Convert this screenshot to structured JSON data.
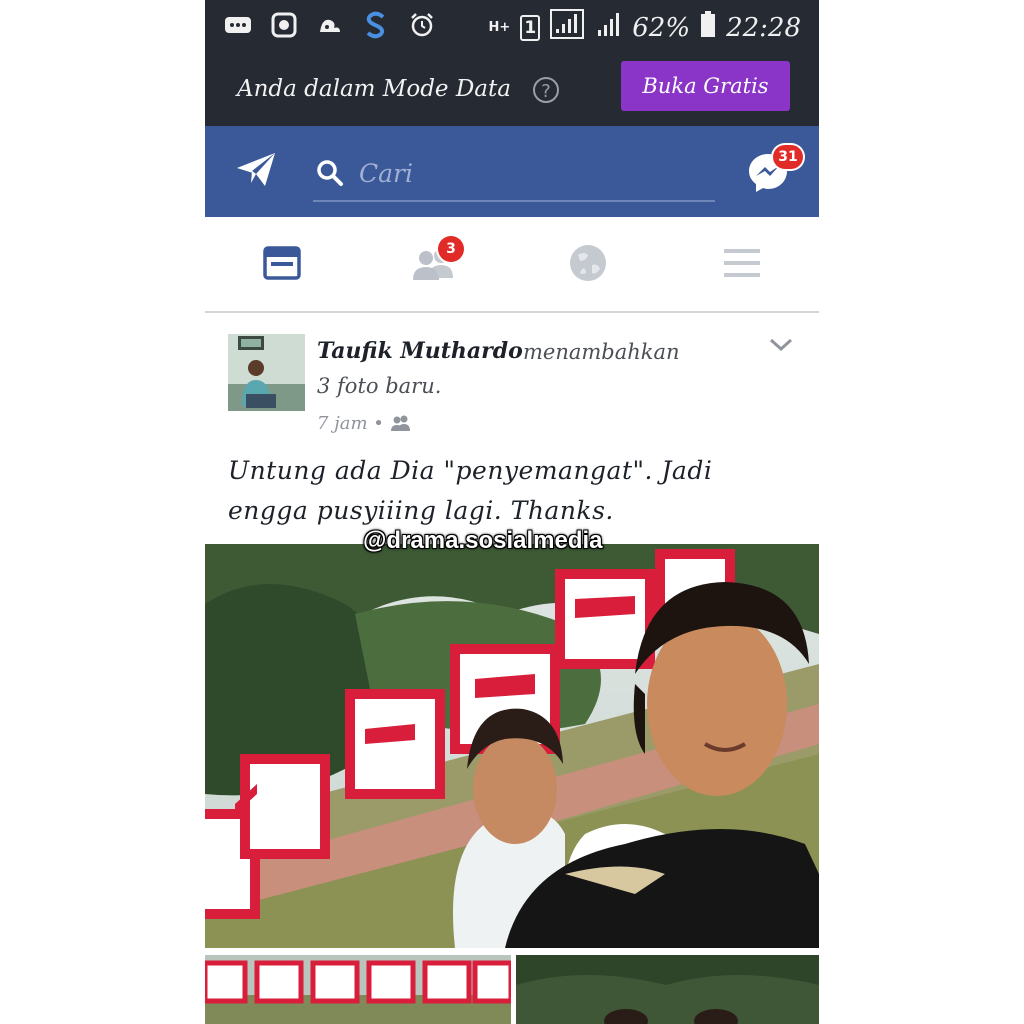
{
  "status_bar": {
    "network_label": "H+",
    "sim": "1",
    "battery": "62%",
    "time": "22:28"
  },
  "data_banner": {
    "text": "Anda dalam Mode Data",
    "help": "?",
    "button_label": "Buka Gratis"
  },
  "header": {
    "search_placeholder": "Cari",
    "messenger_badge": "31"
  },
  "tabs": {
    "friend_requests_badge": "3"
  },
  "post": {
    "author": "Taufik Muthardo",
    "action_line1": "menambahkan",
    "action_line2": "3 foto baru.",
    "time": "7 jam •",
    "caption": "Untung ada Dia \"penyemangat\". Jadi engga pusyiiing lagi.  Thanks.",
    "watermark": "@drama.sosialmedia"
  },
  "colors": {
    "status_bar_bg": "#252a33",
    "facebook_blue": "#3b5998",
    "free_button": "#8b35c8",
    "badge_red": "#e02b27"
  }
}
